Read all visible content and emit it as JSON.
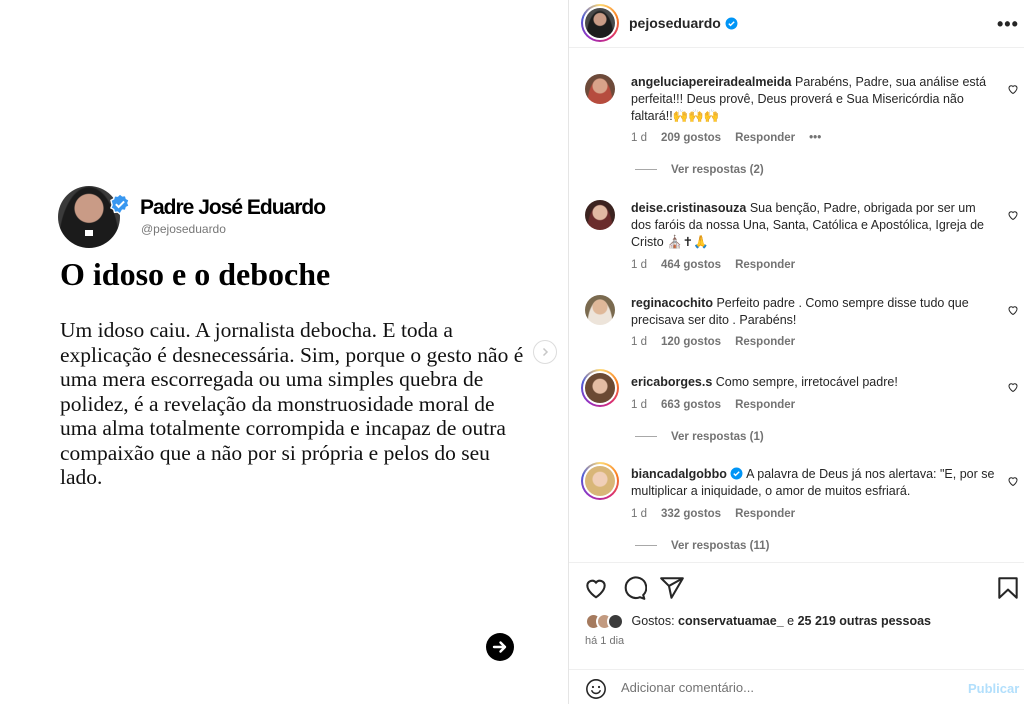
{
  "post": {
    "author_name": "Padre José Eduardo",
    "author_handle": "@pejoseduardo",
    "title": "O idoso e o deboche",
    "body": "Um idoso caiu. A jornalista debocha. E toda a explicação é desnecessária. Sim, porque o gesto não é uma mera escorregada ou uma simples quebra de polidez, é a revelação da monstruosidade moral de uma alma totalmente corrompida e incapaz de outra compaixão que a não por si própria e pelos do seu lado."
  },
  "header": {
    "username": "pejoseduardo"
  },
  "comments": [
    {
      "user": "angeluciapereiradealmeida",
      "text": "Parabéns, Padre, sua análise está perfeita!!! Deus provê, Deus proverá e Sua Misericórdia não faltará!!🙌🙌🙌",
      "time": "1 d",
      "likes": "209 gostos",
      "reply": "Responder",
      "more": "•••",
      "view_replies": "Ver respostas (2)"
    },
    {
      "user": "deise.cristinasouza",
      "text": "Sua benção, Padre, obrigada por ser um dos faróis da nossa Una, Santa, Católica e Apostólica, Igreja de Cristo ⛪✝🙏",
      "time": "1 d",
      "likes": "464 gostos",
      "reply": "Responder"
    },
    {
      "user": "reginacochito",
      "text": "Perfeito padre . Como sempre disse tudo que precisava ser dito . Parabéns!",
      "time": "1 d",
      "likes": "120 gostos",
      "reply": "Responder"
    },
    {
      "user": "ericaborges.s",
      "text": "Como sempre, irretocável padre!",
      "time": "1 d",
      "likes": "663 gostos",
      "reply": "Responder",
      "view_replies": "Ver respostas (1)"
    },
    {
      "user": "biancadalgobbo",
      "text": "A palavra de Deus já nos alertava: \"E, por se multiplicar a iniquidade, o amor de muitos esfriará.",
      "time": "1 d",
      "likes": "332 gostos",
      "reply": "Responder",
      "view_replies": "Ver respostas (11)"
    }
  ],
  "likes": {
    "prefix": "Gostos:",
    "first_user": "conservatuamae_",
    "and": "e",
    "others": "25 219 outras pessoas"
  },
  "date": "há 1 dia",
  "comment_box": {
    "placeholder": "Adicionar comentário...",
    "publish": "Publicar"
  },
  "colors": {
    "verified": "#0095f6",
    "publish_disabled": "#b2dffc",
    "muted": "#737373"
  }
}
